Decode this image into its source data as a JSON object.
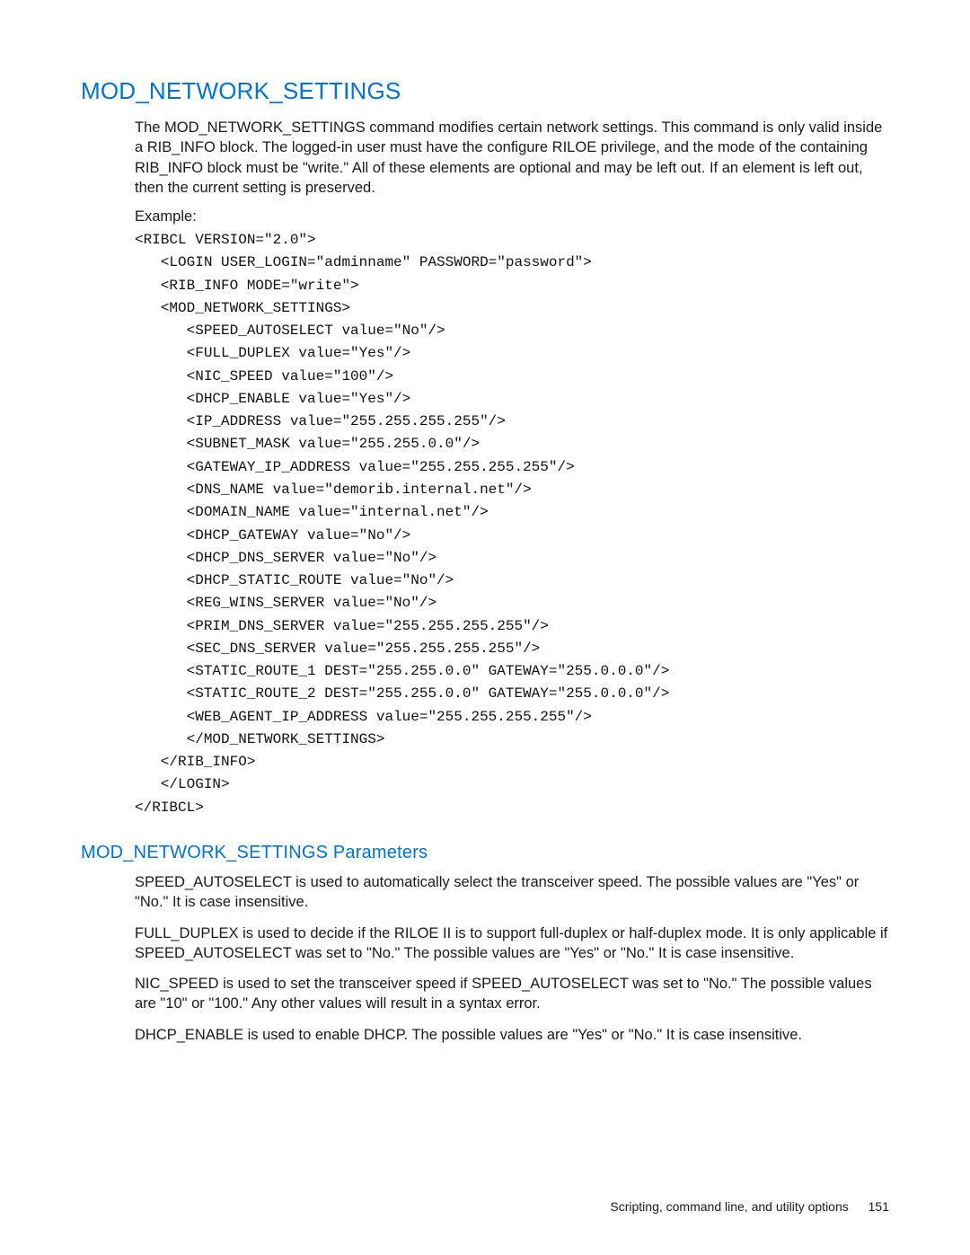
{
  "title": "MOD_NETWORK_SETTINGS",
  "intro": "The MOD_NETWORK_SETTINGS command modifies certain network settings. This command is only valid inside a RIB_INFO block. The logged-in user must have the configure RILOE privilege, and the mode of the containing RIB_INFO block must be \"write.\" All of these elements are optional and may be left out. If an element is left out, then the current setting is preserved.",
  "example_label": "Example:",
  "code": "<RIBCL VERSION=\"2.0\">\n   <LOGIN USER_LOGIN=\"adminname\" PASSWORD=\"password\">\n   <RIB_INFO MODE=\"write\">\n   <MOD_NETWORK_SETTINGS>\n      <SPEED_AUTOSELECT value=\"No\"/>\n      <FULL_DUPLEX value=\"Yes\"/>\n      <NIC_SPEED value=\"100\"/>\n      <DHCP_ENABLE value=\"Yes\"/>\n      <IP_ADDRESS value=\"255.255.255.255\"/>\n      <SUBNET_MASK value=\"255.255.0.0\"/>\n      <GATEWAY_IP_ADDRESS value=\"255.255.255.255\"/>\n      <DNS_NAME value=\"demorib.internal.net\"/>\n      <DOMAIN_NAME value=\"internal.net\"/>\n      <DHCP_GATEWAY value=\"No\"/>\n      <DHCP_DNS_SERVER value=\"No\"/>\n      <DHCP_STATIC_ROUTE value=\"No\"/>\n      <REG_WINS_SERVER value=\"No\"/>\n      <PRIM_DNS_SERVER value=\"255.255.255.255\"/>\n      <SEC_DNS_SERVER value=\"255.255.255.255\"/>\n      <STATIC_ROUTE_1 DEST=\"255.255.0.0\" GATEWAY=\"255.0.0.0\"/>\n      <STATIC_ROUTE_2 DEST=\"255.255.0.0\" GATEWAY=\"255.0.0.0\"/>\n      <WEB_AGENT_IP_ADDRESS value=\"255.255.255.255\"/>\n      </MOD_NETWORK_SETTINGS>\n   </RIB_INFO>\n   </LOGIN>\n</RIBCL>",
  "params_title": "MOD_NETWORK_SETTINGS Parameters",
  "params": {
    "p1": "SPEED_AUTOSELECT is used to automatically select the transceiver speed. The possible values are \"Yes\" or \"No.\" It is case insensitive.",
    "p2": "FULL_DUPLEX is used to decide if the RILOE II is to support full-duplex or half-duplex mode. It is only applicable if SPEED_AUTOSELECT was set to \"No.\" The possible values are \"Yes\" or \"No.\" It is case insensitive.",
    "p3": "NIC_SPEED is used to set the transceiver speed if SPEED_AUTOSELECT was set to \"No.\" The possible values are \"10\" or \"100.\" Any other values will result in a syntax error.",
    "p4": "DHCP_ENABLE is used to enable DHCP. The possible values are \"Yes\" or \"No.\" It is case insensitive."
  },
  "footer": {
    "text": "Scripting, command line, and utility options",
    "page": "151"
  }
}
